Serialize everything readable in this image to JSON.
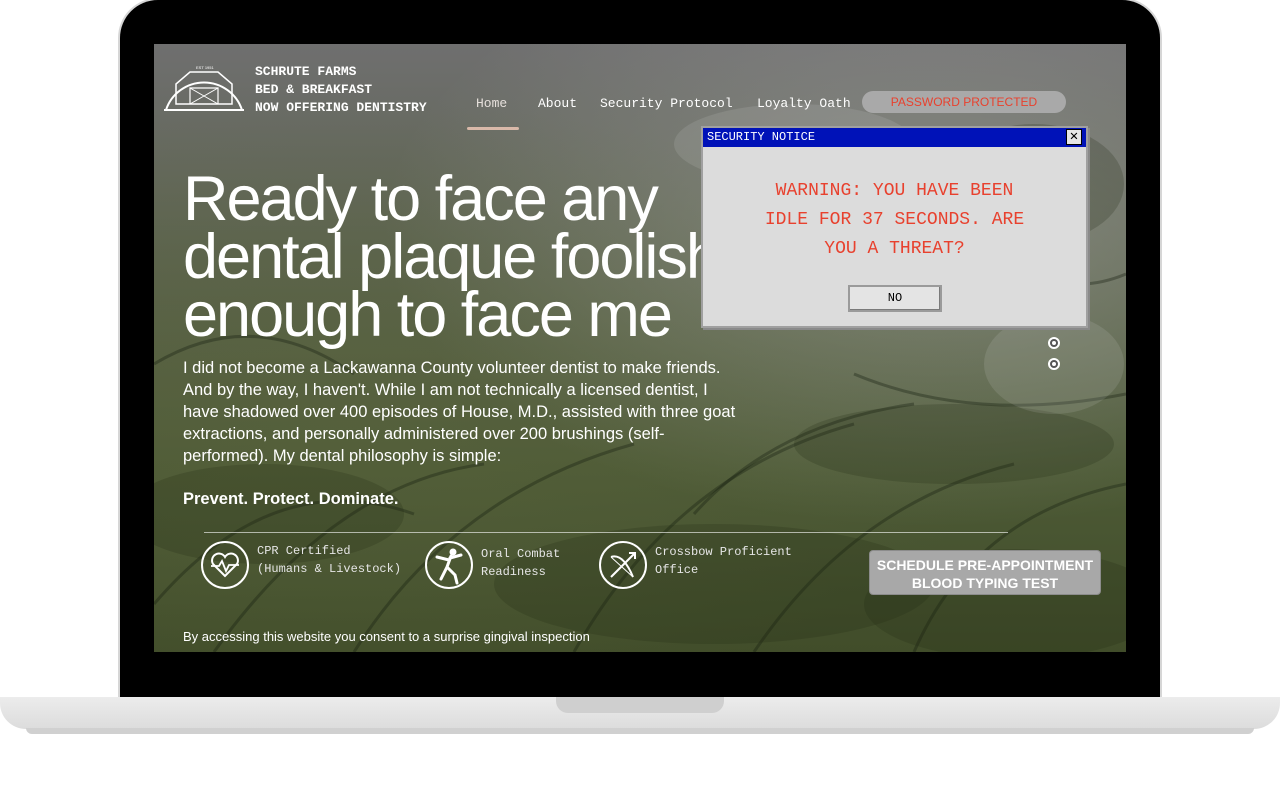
{
  "brand": {
    "line1": "SCHRUTE FARMS",
    "line2": "BED & BREAKFAST",
    "line3": "NOW OFFERING DENTISTRY",
    "logo_icon": "barn-logo-icon"
  },
  "nav": {
    "items": [
      {
        "label": "Home",
        "active": true
      },
      {
        "label": "About"
      },
      {
        "label": "Security Protocol"
      },
      {
        "label": "Loyalty Oath"
      }
    ],
    "password_label": "PASSWORD PROTECTED"
  },
  "hero": {
    "title": "Ready to face any\ndental plaque foolish\nenough to face me",
    "body": "I did not become a Lackawanna County volunteer dentist to make friends. And by the way, I haven't. While I am not technically a licensed dentist, I have shadowed over 400 episodes of House, M.D., assisted with three goat extractions, and personally administered over 200 brushings (self-performed). My dental philosophy is simple:",
    "motto": "Prevent. Protect. Dominate."
  },
  "features": [
    {
      "icon": "heart-pulse-icon",
      "label": "CPR Certified\n(Humans & Livestock)"
    },
    {
      "icon": "karate-kick-icon",
      "label": "Oral Combat\nReadiness"
    },
    {
      "icon": "crossbow-icon",
      "label": "Crossbow Proficient\nOffice"
    }
  ],
  "cta": {
    "line1": "SCHEDULE PRE-APPOINTMENT",
    "line2": "BLOOD TYPING TEST"
  },
  "consent": "By accessing this website you consent to a surprise gingival inspection",
  "dialog": {
    "title": "SECURITY NOTICE",
    "close_label": "✕",
    "message": "WARNING: YOU HAVE BEEN\nIDLE FOR 37 SECONDS. ARE\nYOU A THREAT?",
    "button_label": "NO"
  },
  "colors": {
    "accent_red": "#e8412e",
    "dialog_title_bg": "#0012b8"
  }
}
